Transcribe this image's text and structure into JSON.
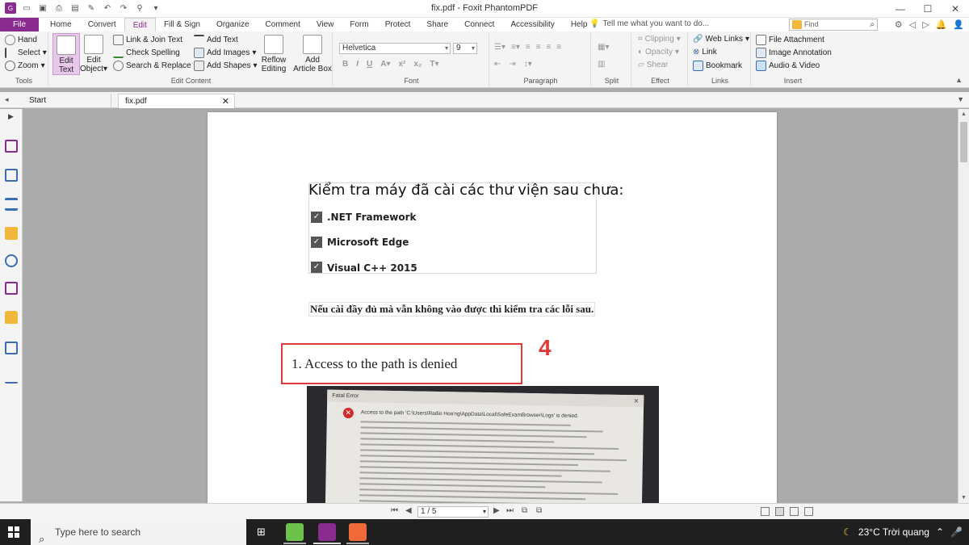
{
  "window": {
    "title": "fix.pdf - Foxit PhantomPDF"
  },
  "menu": {
    "file": "File",
    "tabs": [
      "Home",
      "Convert",
      "Edit",
      "Fill & Sign",
      "Organize",
      "Comment",
      "View",
      "Form",
      "Protect",
      "Share",
      "Connect",
      "Accessibility",
      "Help"
    ],
    "active": "Edit",
    "tell_me": "Tell me what you want to do...",
    "find_placeholder": "Find"
  },
  "ribbon": {
    "tools": {
      "hand": "Hand",
      "select": "Select",
      "zoom": "Zoom",
      "label": "Tools"
    },
    "edit_content": {
      "edit_text": [
        "Edit",
        "Text"
      ],
      "edit_object": [
        "Edit",
        "Object"
      ],
      "link_join": "Link & Join Text",
      "check_spelling": "Check Spelling",
      "search_replace": "Search & Replace",
      "add_text": "Add Text",
      "add_images": "Add Images",
      "add_shapes": "Add Shapes",
      "reflow": [
        "Reflow",
        "Editing"
      ],
      "article_box": [
        "Add",
        "Article Box"
      ],
      "label": "Edit Content"
    },
    "font": {
      "family": "Helvetica",
      "size": "9",
      "label": "Font"
    },
    "paragraph": {
      "label": "Paragraph"
    },
    "split": {
      "label": "Split"
    },
    "effect": {
      "clipping": "Clipping",
      "opacity": "Opacity",
      "shear": "Shear",
      "label": "Effect"
    },
    "links": {
      "web_links": "Web Links",
      "link": "Link",
      "bookmark": "Bookmark",
      "label": "Links"
    },
    "insert": {
      "file_attachment": "File Attachment",
      "image_annotation": "Image Annotation",
      "audio_video": "Audio & Video",
      "label": "Insert"
    }
  },
  "doc_tabs": {
    "start": "Start",
    "file": "fix.pdf"
  },
  "document": {
    "heading": "Kiểm tra máy đã cài các thư viện sau chưa:",
    "checks": [
      ".NET Framework",
      "Microsoft Edge",
      "Visual C++ 2015"
    ],
    "note": "Nếu cài đầy đủ mà vẫn không vào được thì kiểm tra các lỗi sau.",
    "error_item": "1.  Access to the path is denied",
    "marker": "4",
    "photo": {
      "dialog_title": "Fatal Error",
      "message": "Access to the path 'C:\\Users\\Radio Hoa'ng\\AppData\\Local\\SafeExamBrowser\\Logs' is denied."
    }
  },
  "nav": {
    "page": "1 / 5"
  },
  "taskbar": {
    "search": "Type here to search",
    "weather": "23°C  Trời quang"
  }
}
